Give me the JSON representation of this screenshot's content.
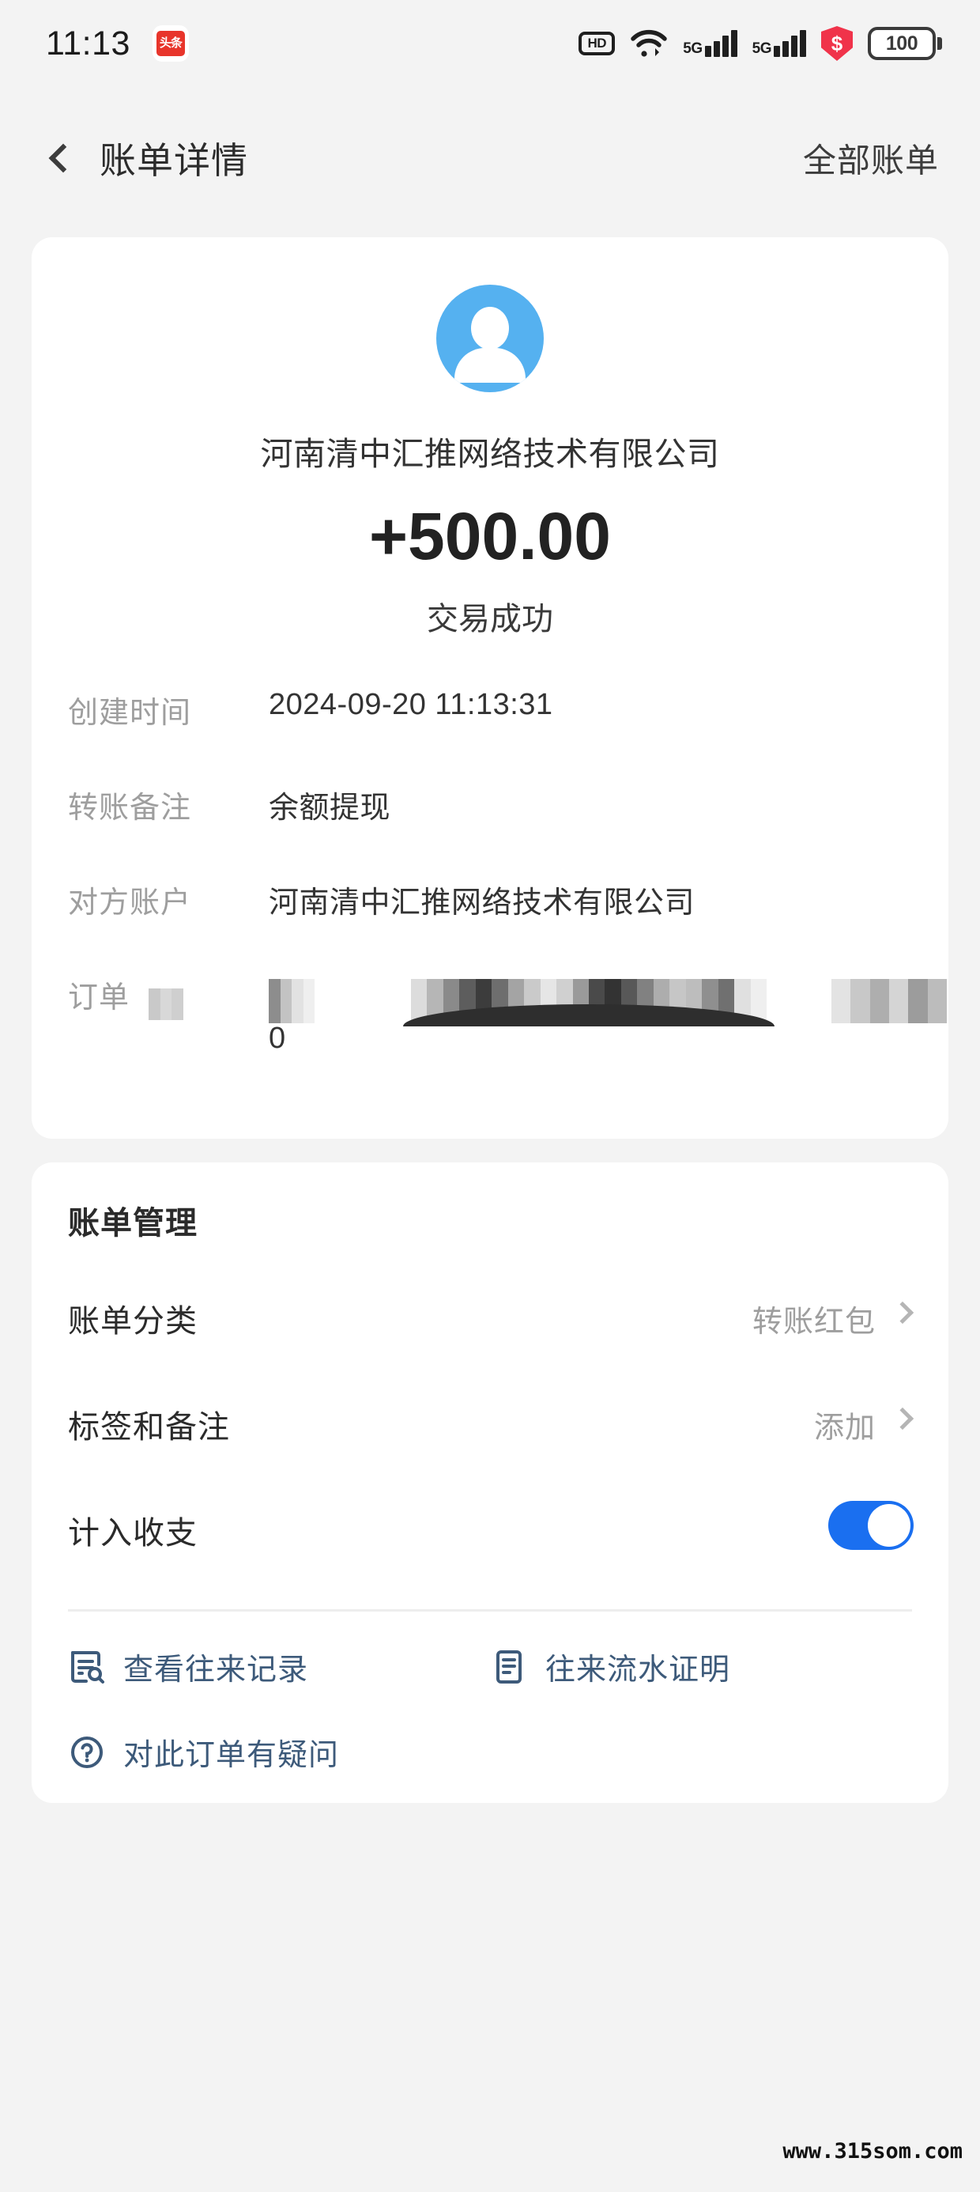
{
  "status_bar": {
    "time": "11:13",
    "app_badge_label": "头条",
    "icons": [
      "hd-icon",
      "wifi-icon",
      "5g-signal-icon",
      "5g-signal-icon",
      "shield-dollar-icon",
      "battery-icon"
    ],
    "network_label_1": "5G",
    "network_label_2": "5G",
    "hd_label": "HD",
    "battery_level": "100"
  },
  "nav": {
    "back_icon": "chevron-left-icon",
    "title": "账单详情",
    "right_action": "全部账单"
  },
  "detail_card": {
    "avatar_icon": "person-avatar-icon",
    "payee_name": "河南清中汇推网络技术有限公司",
    "amount": "+500.00",
    "status": "交易成功",
    "rows": [
      {
        "label": "创建时间",
        "value": "2024-09-20 11:13:31"
      },
      {
        "label": "转账备注",
        "value": "余额提现"
      },
      {
        "label": "对方账户",
        "value": "河南清中汇推网络技术有限公司"
      },
      {
        "label": "订单",
        "value": "",
        "value_second_line": "0",
        "redacted": true
      }
    ]
  },
  "manage_card": {
    "title": "账单管理",
    "rows": [
      {
        "label": "账单分类",
        "value": "转账红包",
        "control": "chevron-right-icon"
      },
      {
        "label": "标签和备注",
        "value": "添加",
        "control": "chevron-right-icon"
      },
      {
        "label": "计入收支",
        "value": "",
        "control": "toggle-on"
      }
    ],
    "links": [
      {
        "icon": "document-search-icon",
        "label": "查看往来记录"
      },
      {
        "icon": "document-lines-icon",
        "label": "往来流水证明"
      },
      {
        "icon": "question-circle-icon",
        "label": "对此订单有疑问"
      }
    ]
  },
  "watermark": "www.315som.com",
  "colors": {
    "background": "#f3f3f3",
    "card": "#ffffff",
    "avatar_blue": "#55b1f0",
    "toggle_blue": "#1a6ff0",
    "link_blue": "#3d5a7a",
    "shield_red": "#f0334a",
    "badge_red": "#e8352b",
    "label_gray": "#9e9e9e"
  }
}
